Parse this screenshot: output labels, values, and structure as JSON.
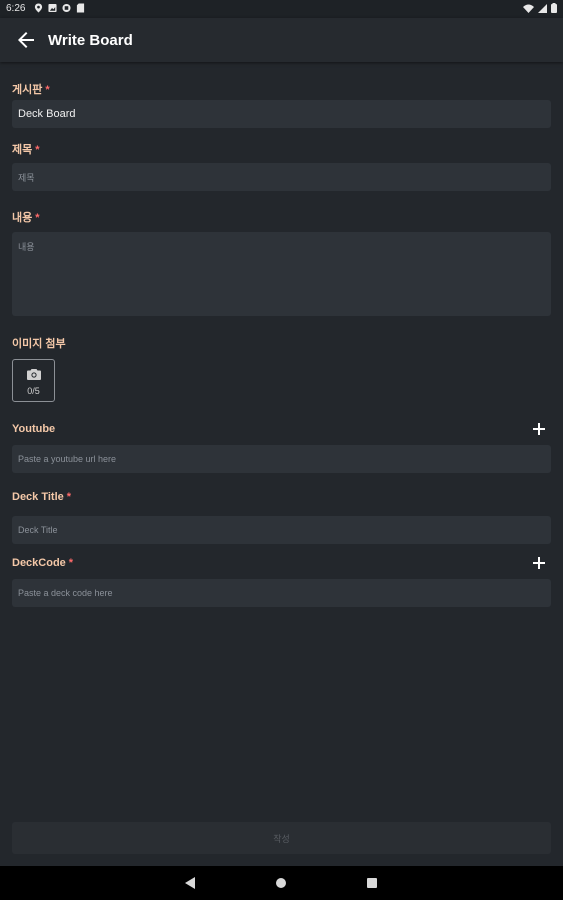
{
  "status_bar": {
    "time": "6:26"
  },
  "app_bar": {
    "title": "Write Board"
  },
  "form": {
    "board": {
      "label": "게시판",
      "required_mark": "*",
      "value": "Deck Board"
    },
    "title": {
      "label": "제목",
      "required_mark": "*",
      "placeholder": "제목"
    },
    "content": {
      "label": "내용",
      "required_mark": "*",
      "placeholder": "내용"
    },
    "images": {
      "label": "이미지 첨부",
      "count": "0/5"
    },
    "youtube": {
      "label": "Youtube",
      "placeholder": "Paste a youtube url here"
    },
    "deck_title": {
      "label": "Deck Title",
      "required_mark": "*",
      "placeholder": "Deck Title"
    },
    "deck_code": {
      "label": "DeckCode",
      "required_mark": "*",
      "placeholder": "Paste a deck code here"
    }
  },
  "submit": {
    "label": "작성"
  },
  "colors": {
    "background": "#23272c",
    "label": "#f4c8a8",
    "required": "#ff6b6b",
    "field": "#2e3339"
  }
}
